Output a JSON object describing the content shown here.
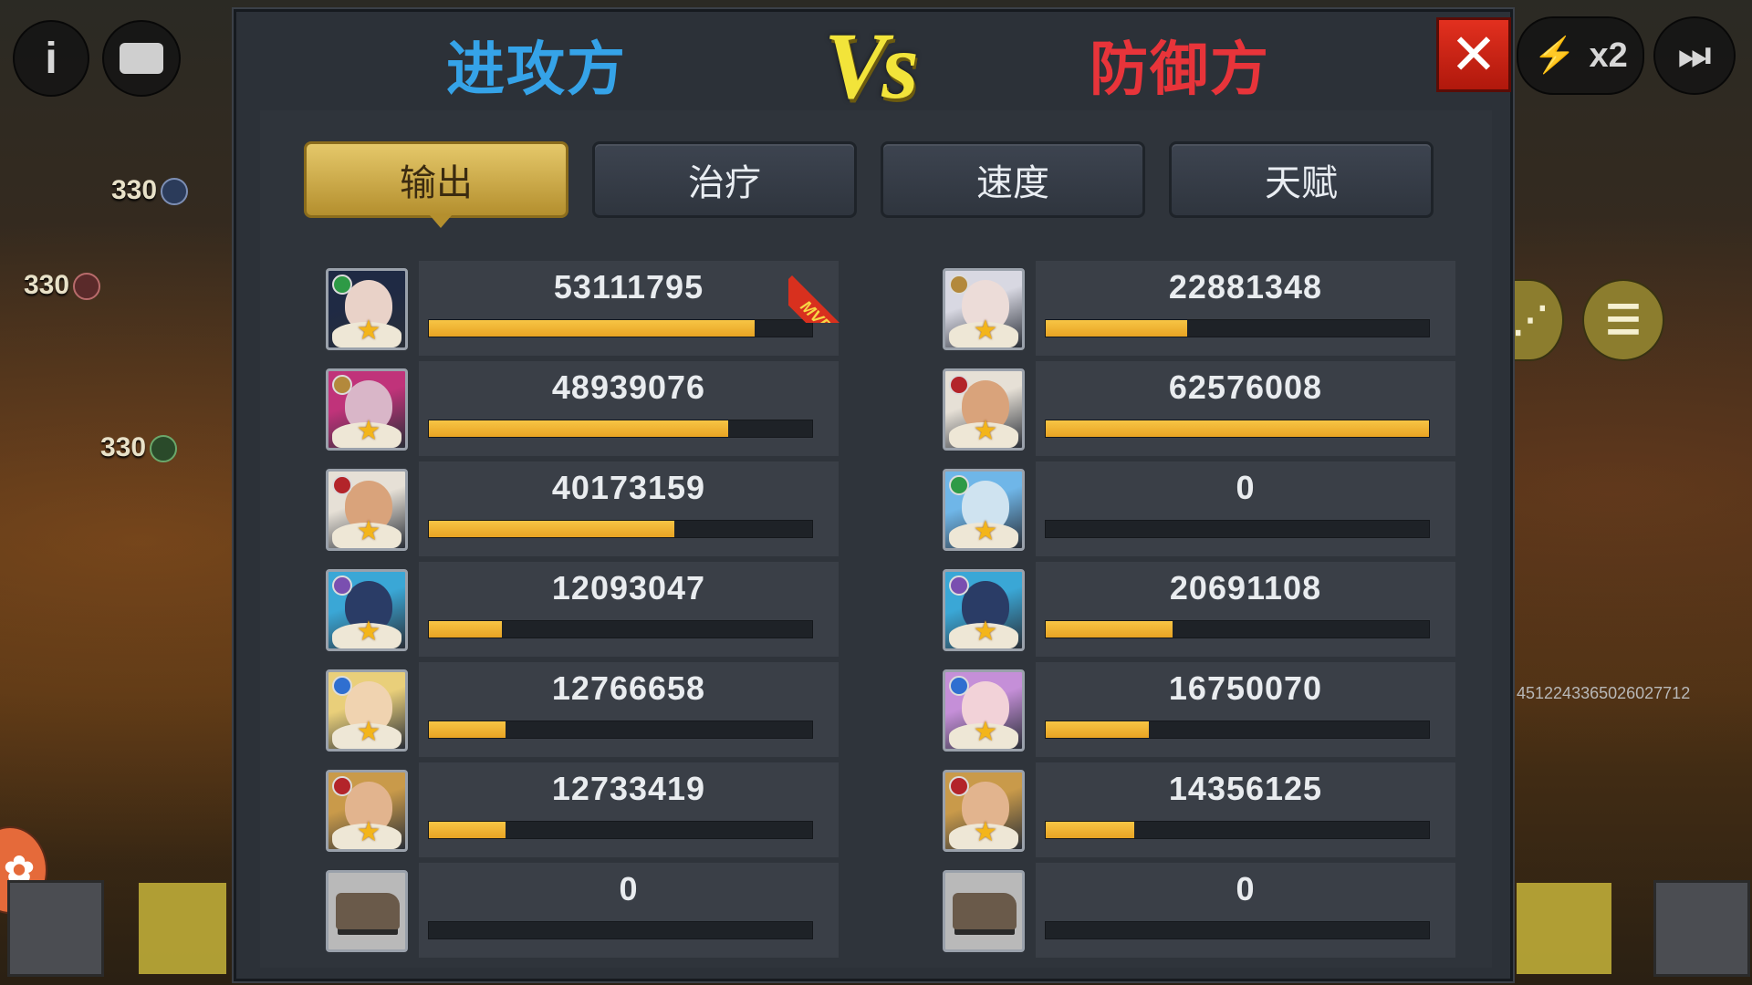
{
  "header": {
    "attacker_title": "进攻方",
    "vs_label": "Vs",
    "defender_title": "防御方",
    "close_symbol": "✕"
  },
  "tabs": [
    {
      "label": "输出",
      "active": true
    },
    {
      "label": "治疗",
      "active": false
    },
    {
      "label": "速度",
      "active": false
    },
    {
      "label": "天赋",
      "active": false
    }
  ],
  "attackers": [
    {
      "value": "53111795",
      "ratio": 0.85,
      "mvp": true,
      "avatar_icon": "hero-portrait-icon",
      "face": "#e9d2c8",
      "hair": "#1f2a44",
      "badge": "#2e9a46"
    },
    {
      "value": "48939076",
      "ratio": 0.78,
      "mvp": false,
      "avatar_icon": "hero-portrait-icon",
      "face": "#d9b6c8",
      "hair": "#c0337a",
      "badge": "#b3893c"
    },
    {
      "value": "40173159",
      "ratio": 0.64,
      "mvp": false,
      "avatar_icon": "hero-portrait-icon",
      "face": "#d9a37b",
      "hair": "#e6e0d6",
      "badge": "#b3242a"
    },
    {
      "value": "12093047",
      "ratio": 0.19,
      "mvp": false,
      "avatar_icon": "hero-portrait-icon",
      "face": "#2a3c66",
      "hair": "#3aa7d6",
      "badge": "#7a4fb0"
    },
    {
      "value": "12766658",
      "ratio": 0.2,
      "mvp": false,
      "avatar_icon": "hero-portrait-icon",
      "face": "#f0d3b0",
      "hair": "#e9cf7a",
      "badge": "#2f6fd0"
    },
    {
      "value": "12733419",
      "ratio": 0.2,
      "mvp": false,
      "avatar_icon": "hero-portrait-icon",
      "face": "#e2b48e",
      "hair": "#c99a4a",
      "badge": "#b3242a"
    },
    {
      "value": "0",
      "ratio": 0,
      "mvp": false,
      "avatar_icon": "vehicle-icon",
      "face": "",
      "hair": "",
      "badge": ""
    }
  ],
  "defenders": [
    {
      "value": "22881348",
      "ratio": 0.37,
      "avatar_icon": "hero-portrait-icon",
      "face": "#ecdcd8",
      "hair": "#d8d8e2",
      "badge": "#b3893c"
    },
    {
      "value": "62576008",
      "ratio": 1.0,
      "avatar_icon": "hero-portrait-icon",
      "face": "#d9a37b",
      "hair": "#e6e0d6",
      "badge": "#b3242a"
    },
    {
      "value": "0",
      "ratio": 0,
      "avatar_icon": "hero-portrait-icon",
      "face": "#cfe3f0",
      "hair": "#6fb6e8",
      "badge": "#2e9a46"
    },
    {
      "value": "20691108",
      "ratio": 0.33,
      "avatar_icon": "hero-portrait-icon",
      "face": "#2a3c66",
      "hair": "#3aa7d6",
      "badge": "#7a4fb0"
    },
    {
      "value": "16750070",
      "ratio": 0.27,
      "avatar_icon": "hero-portrait-icon",
      "face": "#f2d2d8",
      "hair": "#c58fd8",
      "badge": "#2f6fd0"
    },
    {
      "value": "14356125",
      "ratio": 0.23,
      "avatar_icon": "hero-portrait-icon",
      "face": "#e2b48e",
      "hair": "#c99a4a",
      "badge": "#b3242a"
    },
    {
      "value": "0",
      "ratio": 0,
      "avatar_icon": "vehicle-icon",
      "face": "",
      "hair": "",
      "badge": ""
    }
  ],
  "mvp_label": "MVP",
  "background": {
    "unit_levels": [
      "330",
      "330",
      "330"
    ],
    "speed_label": "x2",
    "id_text": "4512243365026027712"
  },
  "colors": {
    "attacker": "#35a3e8",
    "defender": "#e8343a",
    "vs": "#f2e43a",
    "bar_fill": "#f0b432",
    "tab_active": "#d4b04c"
  }
}
